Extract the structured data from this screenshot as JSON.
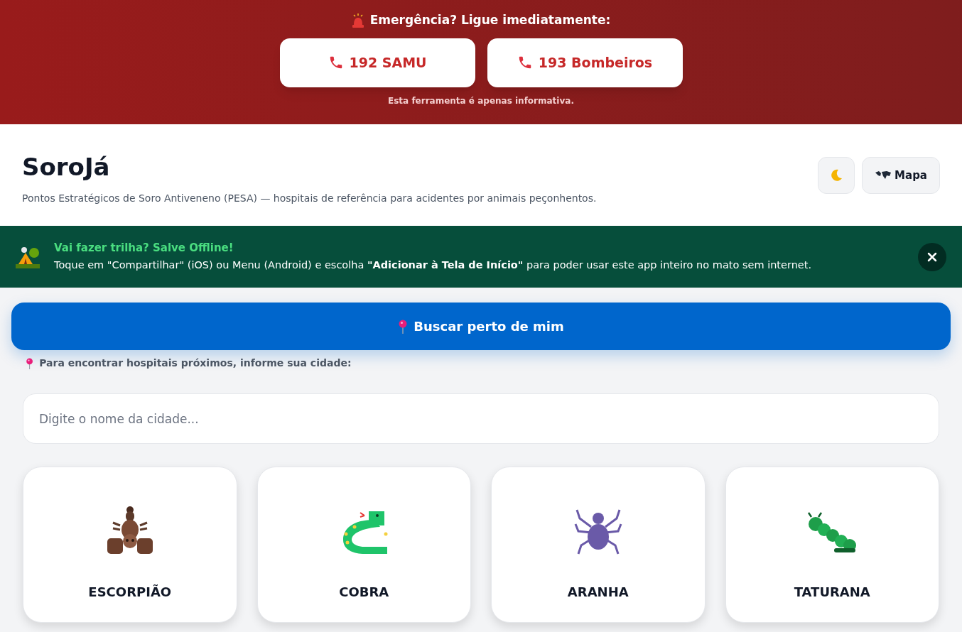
{
  "emergency": {
    "title": "Emergência? Ligue imediatamente:",
    "buttons": [
      {
        "label": "192 SAMU"
      },
      {
        "label": "193 Bombeiros"
      }
    ],
    "note": "Esta ferramenta é apenas informativa."
  },
  "header": {
    "title": "SoroJá",
    "subtitle": "Pontos Estratégicos de Soro Antiveneno (PESA) — hospitais de referência para acidentes por animais peçonhentos.",
    "map_button": "Mapa"
  },
  "offline_banner": {
    "title": "Vai fazer trilha? Salve Offline!",
    "text": "Toque em \"Compartilhar\" (iOS) ou Menu (Android) e escolha **\"Adicionar à Tela de Início\"** para poder usar este app inteiro no mato sem internet."
  },
  "nearby_button": "Buscar perto de mim",
  "city_hint": "Para encontrar hospitais próximos, informe sua cidade:",
  "city_search": {
    "placeholder": "Digite o nome da cidade..."
  },
  "animals": [
    {
      "kind": "scorpion",
      "label": "ESCORPIÃO"
    },
    {
      "kind": "snake",
      "label": "COBRA"
    },
    {
      "kind": "spider",
      "label": "ARANHA"
    },
    {
      "kind": "caterpillar",
      "label": "TATURANA"
    }
  ]
}
